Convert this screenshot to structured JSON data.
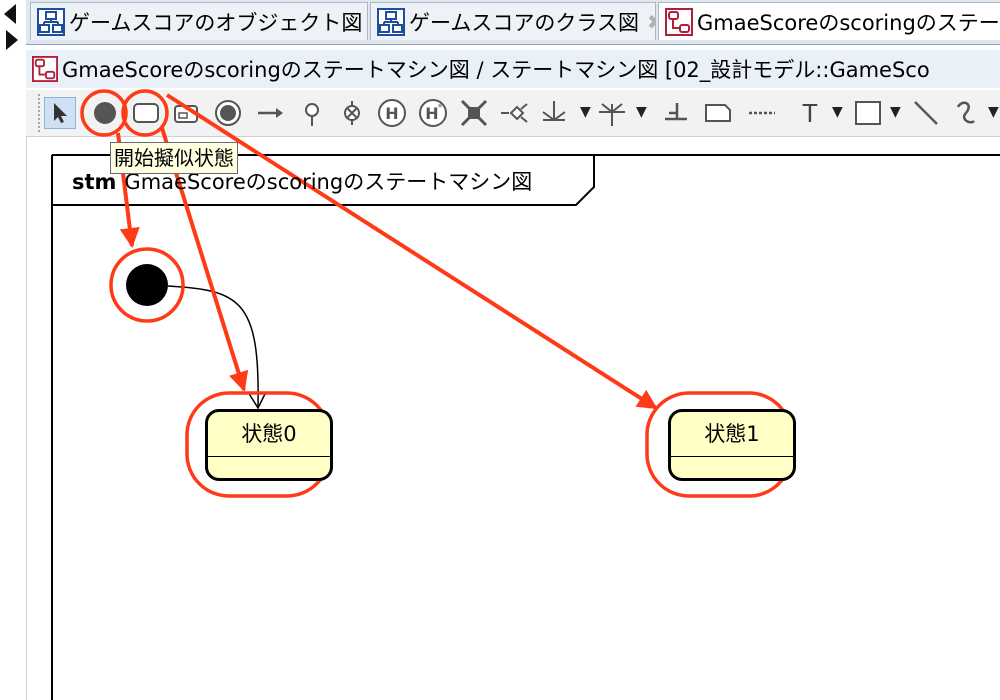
{
  "tabs": [
    {
      "label": "ゲームスコアのオブジェクト図",
      "icon": "class-diagram-icon"
    },
    {
      "label": "ゲームスコアのクラス図",
      "icon": "class-diagram-icon"
    },
    {
      "label": "GmaeScoreのscoringのステート",
      "icon": "state-machine-icon"
    }
  ],
  "diagram_header": {
    "title": "GmaeScoreのscoringのステートマシン図 / ステートマシン図 [02_設計モデル::GameSco"
  },
  "toolbar": {
    "tools": [
      "select-tool-icon",
      "initial-pseudostate-icon",
      "state-icon",
      "submachine-state-icon",
      "final-state-icon",
      "transition-icon",
      "junction-icon",
      "terminate-icon",
      "shallow-history-icon",
      "deep-history-icon",
      "fork-join-icon",
      "choice-icon",
      "entry-point-icon",
      "exit-point-icon",
      "connection-point-icon",
      "note-icon",
      "note-anchor-icon",
      "text-tool-icon",
      "rectangle-tool-icon",
      "line-tool-icon",
      "curve-tool-icon"
    ],
    "text_tool_glyph": "T"
  },
  "tooltip": {
    "text": "開始擬似状態"
  },
  "frame": {
    "keyword": "stm",
    "name": "GmaeScoreのscoringのステートマシン図"
  },
  "states": [
    {
      "name": "状態0"
    },
    {
      "name": "状態1"
    }
  ],
  "colors": {
    "annotation": "#ff3a17",
    "state_fill": "#ffffc6",
    "selected_tool": "#cfe0f4"
  }
}
